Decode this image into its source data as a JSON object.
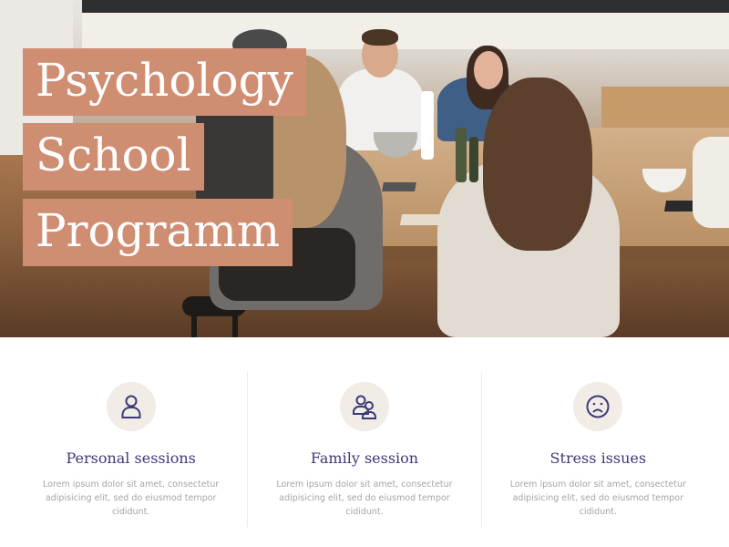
{
  "hero": {
    "title_lines": [
      "Psychology",
      "School",
      "Programm"
    ]
  },
  "features": [
    {
      "icon": "person-icon",
      "title": "Personal sessions",
      "desc": "Lorem ipsum dolor sit amet, consectetur adipisicing elit, sed do eiusmod tempor cididunt."
    },
    {
      "icon": "group-icon",
      "title": "Family session",
      "desc": "Lorem ipsum dolor sit amet, consectetur adipisicing elit, sed do eiusmod tempor cididunt."
    },
    {
      "icon": "sad-face-icon",
      "title": "Stress issues",
      "desc": "Lorem ipsum dolor sit amet, consectetur adipisicing elit, sed do eiusmod tempor cididunt."
    }
  ],
  "colors": {
    "accent": "#cf8d72",
    "icon": "#3c3a78",
    "icon_bg": "#f1ece6",
    "text_muted": "#a4a4a4"
  }
}
